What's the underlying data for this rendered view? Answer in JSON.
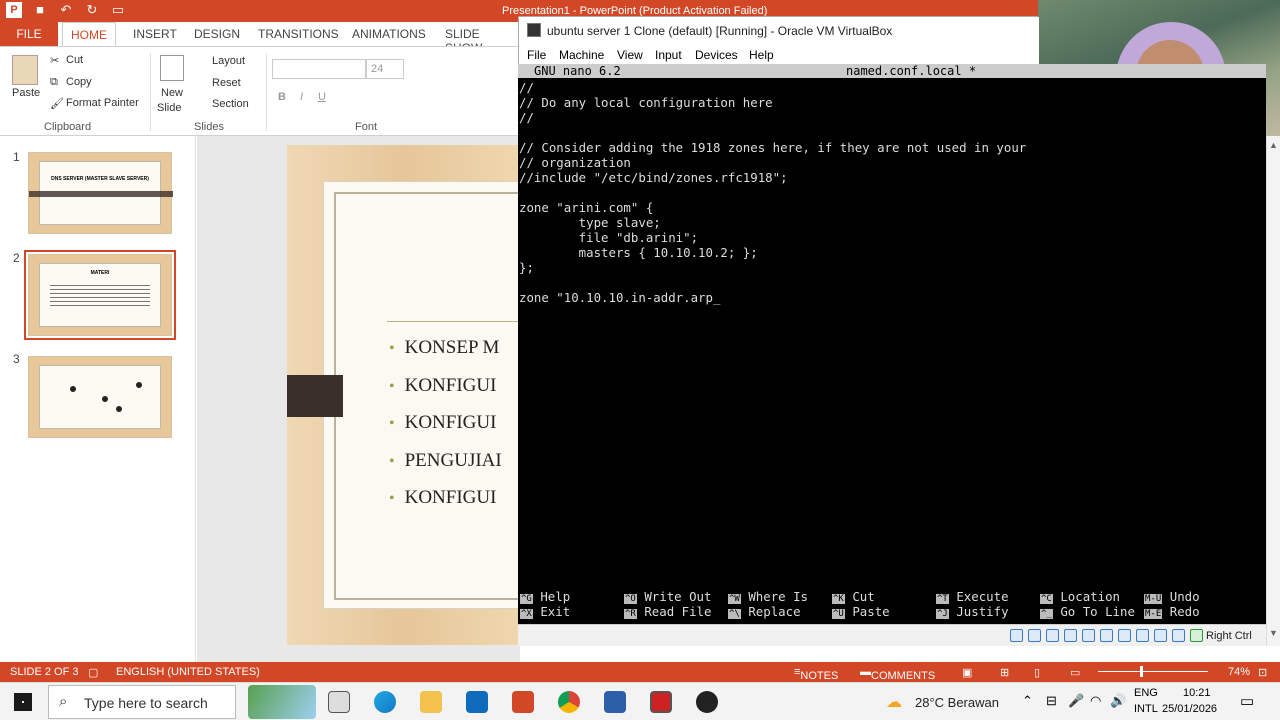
{
  "powerpoint": {
    "window_title": "Presentation1 - PowerPoint (Product Activation Failed)",
    "tabs": [
      "FILE",
      "HOME",
      "INSERT",
      "DESIGN",
      "TRANSITIONS",
      "ANIMATIONS",
      "SLIDE SHOW"
    ],
    "ribbon": {
      "paste": "Paste",
      "cut": "Cut",
      "copy": "Copy",
      "format_painter": "Format Painter",
      "clipboard_group": "Clipboard",
      "new_slide": "New",
      "new_slide2": "Slide",
      "layout": "Layout",
      "reset": "Reset",
      "section": "Section",
      "slides_group": "Slides",
      "font_size": "24",
      "font_group": "Font"
    },
    "thumbnails": [
      {
        "number": "1",
        "title": "DNS SERVER (MASTER SLAVE SERVER)"
      },
      {
        "number": "2",
        "title": "MATERI"
      },
      {
        "number": "3",
        "title": ""
      }
    ],
    "slide_bullets": [
      "KONSEP M",
      "KONFIGUI",
      "KONFIGUI",
      "PENGUJIAI",
      "KONFIGUI"
    ],
    "status": {
      "slide": "SLIDE 2 OF 3",
      "language": "ENGLISH (UNITED STATES)",
      "notes": "NOTES",
      "comments": "COMMENTS",
      "zoom": "74%"
    }
  },
  "virtualbox": {
    "title": "ubuntu server 1 Clone (default) [Running] - Oracle VM VirtualBox",
    "menu": [
      "File",
      "Machine",
      "View",
      "Input",
      "Devices",
      "Help"
    ],
    "right_ctrl": "Right Ctrl"
  },
  "nano": {
    "version": "GNU nano 6.2",
    "filename": "named.conf.local *",
    "lines": [
      "//",
      "// Do any local configuration here",
      "//",
      "",
      "// Consider adding the 1918 zones here, if they are not used in your",
      "// organization",
      "//include \"/etc/bind/zones.rfc1918\";",
      "",
      "zone \"arini.com\" {",
      "        type slave;",
      "        file \"db.arini\";",
      "        masters { 10.10.10.2; };",
      "};",
      "",
      "zone \"10.10.10.in-addr.arp"
    ],
    "shortcuts": [
      {
        "k1": "^G",
        "l1": "Help",
        "k2": "^X",
        "l2": "Exit"
      },
      {
        "k1": "^O",
        "l1": "Write Out",
        "k2": "^R",
        "l2": "Read File"
      },
      {
        "k1": "^W",
        "l1": "Where Is",
        "k2": "^\\",
        "l2": "Replace"
      },
      {
        "k1": "^K",
        "l1": "Cut",
        "k2": "^U",
        "l2": "Paste"
      },
      {
        "k1": "^T",
        "l1": "Execute",
        "k2": "^J",
        "l2": "Justify"
      },
      {
        "k1": "^C",
        "l1": "Location",
        "k2": "^_",
        "l2": "Go To Line"
      },
      {
        "k1": "M-U",
        "l1": "Undo",
        "k2": "M-E",
        "l2": "Redo"
      }
    ]
  },
  "taskbar": {
    "search_placeholder": "Type here to search",
    "weather": "28°C  Berawan",
    "lang1": "ENG",
    "lang2": "INTL",
    "time": "10:21",
    "date": "25/01/2026"
  }
}
